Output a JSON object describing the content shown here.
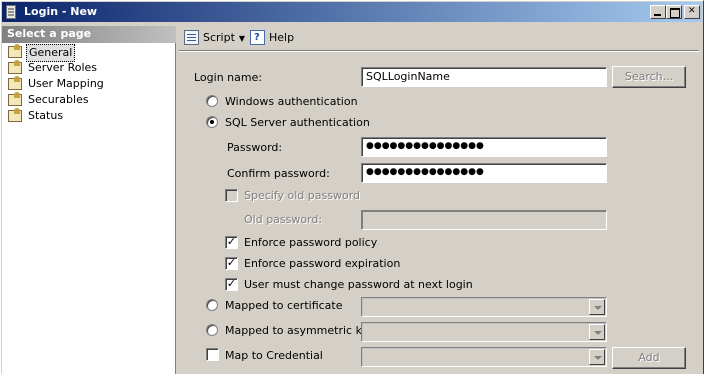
{
  "window": {
    "title": "Login - New"
  },
  "sidebar": {
    "header": "Select a page",
    "items": [
      {
        "label": "General",
        "selected": true
      },
      {
        "label": "Server Roles"
      },
      {
        "label": "User Mapping"
      },
      {
        "label": "Securables"
      },
      {
        "label": "Status"
      }
    ]
  },
  "toolbar": {
    "script_label": "Script",
    "help_label": "Help"
  },
  "form": {
    "login_name_label": "Login name:",
    "login_name_value": "SQLLoginName",
    "search_button": "Search...",
    "windows_auth_label": "Windows authentication",
    "sql_auth_label": "SQL Server authentication",
    "password_label": "Password:",
    "password_value": "●●●●●●●●●●●●●●●",
    "confirm_password_label": "Confirm password:",
    "confirm_password_value": "●●●●●●●●●●●●●●●",
    "specify_old_password_label": "Specify old password",
    "old_password_label": "Old password:",
    "enforce_policy_label": "Enforce password policy",
    "enforce_expiration_label": "Enforce password expiration",
    "must_change_label": "User must change password at next login",
    "mapped_cert_label": "Mapped to certificate",
    "mapped_asym_label": "Mapped to asymmetric key",
    "map_credential_label": "Map to Credential",
    "add_button": "Add"
  }
}
